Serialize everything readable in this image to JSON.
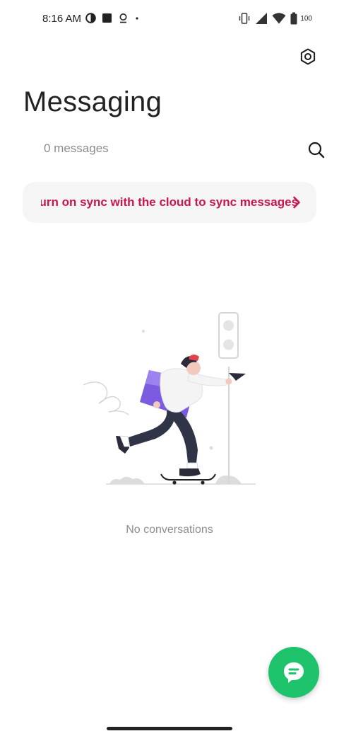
{
  "status_bar": {
    "time": "8:16 AM",
    "battery": "100"
  },
  "header": {
    "title": "Messaging",
    "message_count": "0 messages"
  },
  "sync_banner": {
    "text": "Turn on sync with the cloud to sync messages"
  },
  "empty_state": {
    "label": "No conversations"
  },
  "colors": {
    "accent_red": "#c8174a",
    "fab_green": "#1ec36b",
    "illustration_purple": "#7b5ce0"
  },
  "icons": [
    "settings-icon",
    "search-icon",
    "chevron-right-icon",
    "new-message-icon"
  ]
}
